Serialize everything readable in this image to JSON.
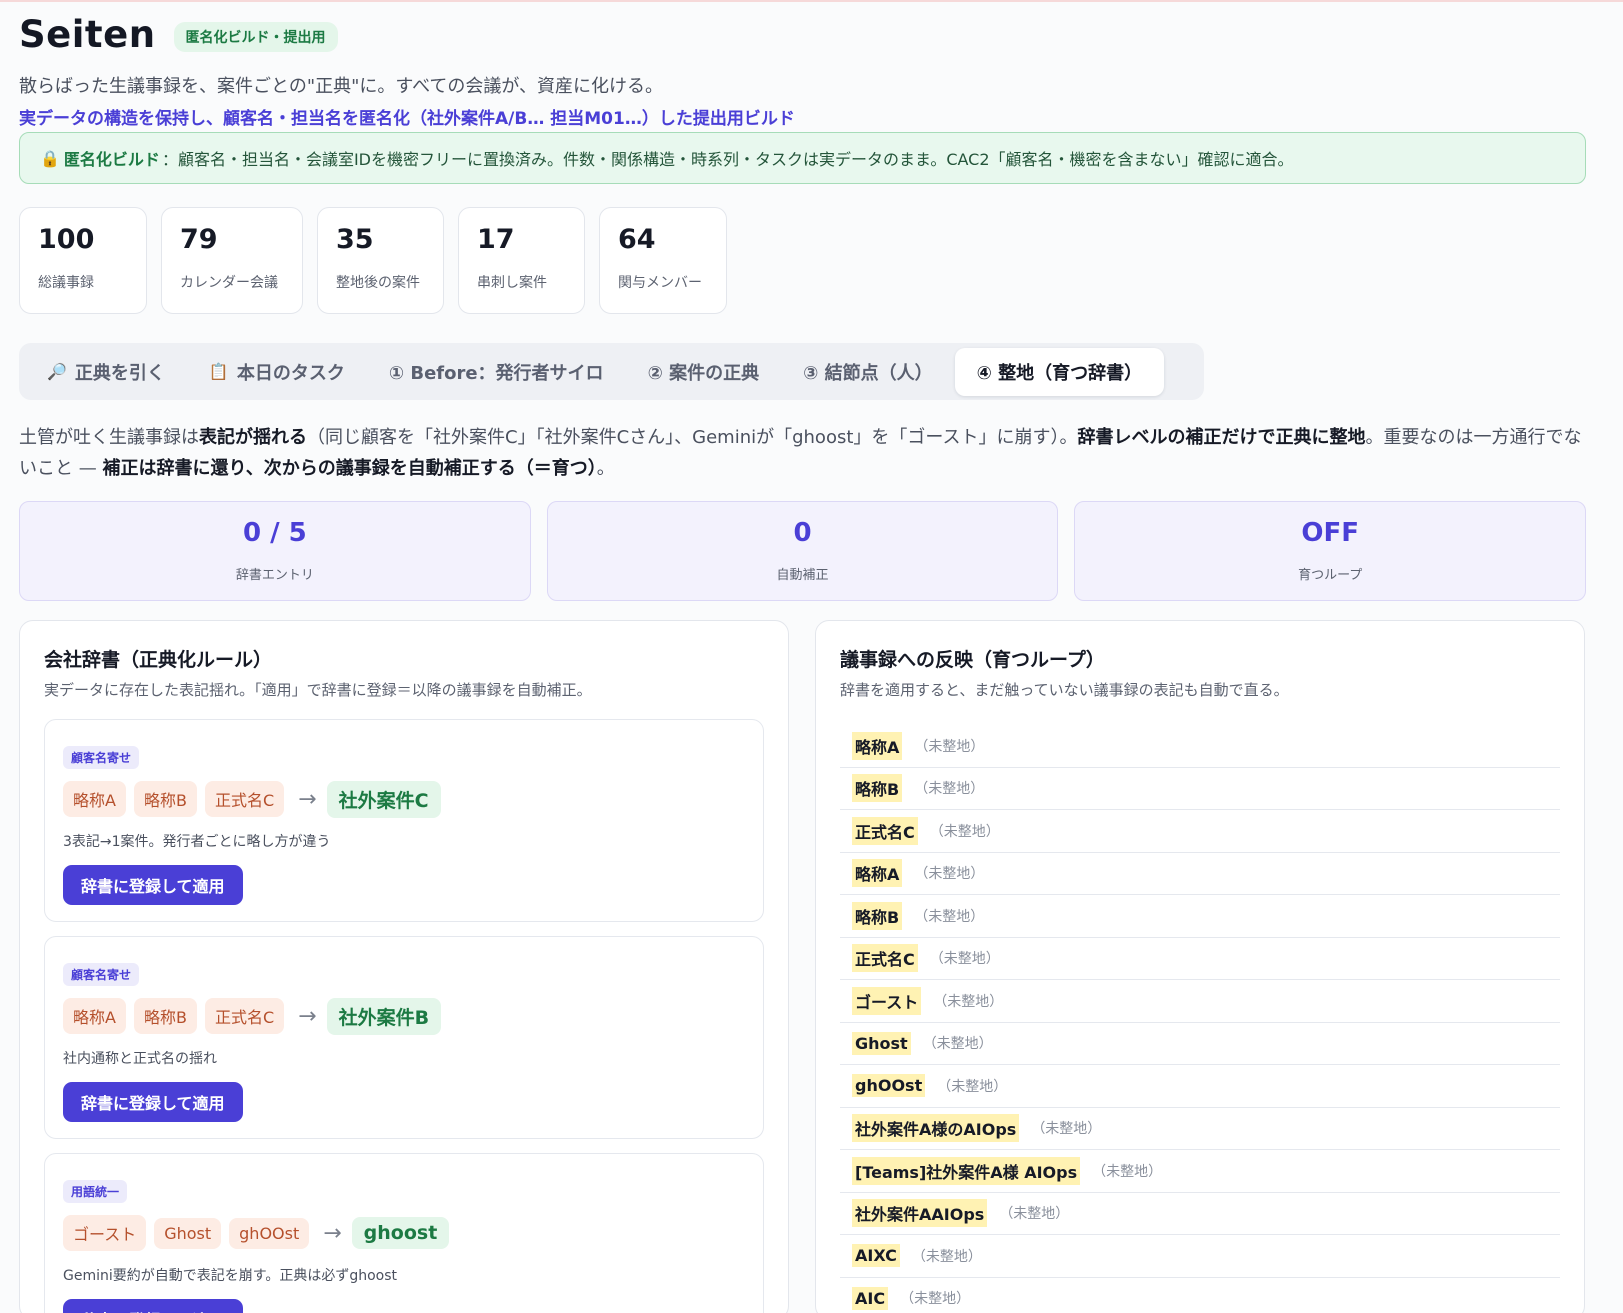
{
  "header": {
    "title": "Seiten",
    "badge": "匿名化ビルド・提出用",
    "tagline": "散らばった生議事録を、案件ごとの\"正典\"に。すべての会議が、資産に化ける。",
    "subline": "実データの構造を保持し、顧客名・担当名を匿名化（社外案件A/B… 担当M01…）した提出用ビルド"
  },
  "notice": {
    "icon": "lock-icon",
    "label": "匿名化ビルド",
    "text": "：顧客名・担当名・会議室IDを機密フリーに置換済み。件数・関係構造・時系列・タスクは実データのまま。CAC2「顧客名・機密を含まない」確認に適合。"
  },
  "stats": [
    {
      "value": "100",
      "label": "総議事録"
    },
    {
      "value": "79",
      "label": "カレンダー会議"
    },
    {
      "value": "35",
      "label": "整地後の案件"
    },
    {
      "value": "17",
      "label": "串刺し案件"
    },
    {
      "value": "64",
      "label": "関与メンバー"
    }
  ],
  "tabs": [
    {
      "icon": "🔎",
      "label": "正典を引く",
      "active": false
    },
    {
      "icon": "📋",
      "label": "本日のタスク",
      "active": false
    },
    {
      "icon": "",
      "label": "① Before：発行者サイロ",
      "active": false
    },
    {
      "icon": "",
      "label": "② 案件の正典",
      "active": false
    },
    {
      "icon": "",
      "label": "③ 結節点（人）",
      "active": false
    },
    {
      "icon": "",
      "label": "④ 整地（育つ辞書）",
      "active": true
    }
  ],
  "description": {
    "p1": "土管が吐く生議事録は",
    "b1": "表記が揺れる",
    "p2": "（同じ顧客を「社外案件C」「社外案件Cさん」、Geminiが「ghoost」を「ゴースト」に崩す）。",
    "b2": "辞書レベルの補正だけで正典に整地",
    "p3": "。重要なのは一方通行でないこと — ",
    "b3": "補正は辞書に還り、次からの議事録を自動補正する（＝育つ）",
    "p4": "。"
  },
  "metrics": [
    {
      "value": "0 / 5",
      "label": "辞書エントリ"
    },
    {
      "value": "0",
      "label": "自動補正"
    },
    {
      "value": "OFF",
      "label": "育つループ"
    }
  ],
  "dictionary": {
    "title": "会社辞書（正典化ルール）",
    "desc": "実データに存在した表記揺れ。「適用」で辞書に登録＝以降の議事録を自動補正。",
    "button_label": "辞書に登録して適用",
    "rules": [
      {
        "tag": "顧客名寄せ",
        "variants": [
          "略称A",
          "略称B",
          "正式名C"
        ],
        "canonical": "社外案件C",
        "note": "3表記→1案件。発行者ごとに略し方が違う"
      },
      {
        "tag": "顧客名寄せ",
        "variants": [
          "略称A",
          "略称B",
          "正式名C"
        ],
        "canonical": "社外案件B",
        "note": "社内通称と正式名の揺れ"
      },
      {
        "tag": "用語統一",
        "variants": [
          "ゴースト",
          "Ghost",
          "ghOOst"
        ],
        "canonical": "ghoost",
        "note": "Gemini要約が自動で表記を崩す。正典は必ずghoost"
      }
    ]
  },
  "reflection": {
    "title": "議事録への反映（育つループ）",
    "desc": "辞書を適用すると、まだ触っていない議事録の表記も自動で直る。",
    "state_label": "（未整地）",
    "items": [
      "略称A",
      "略称B",
      "正式名C",
      "略称A",
      "略称B",
      "正式名C",
      "ゴースト",
      "Ghost",
      "ghOOst",
      "社外案件A様のAIOps",
      "[Teams]社外案件A様 AIOps",
      "社外案件AAIOps",
      "AIXC",
      "AIC"
    ]
  }
}
